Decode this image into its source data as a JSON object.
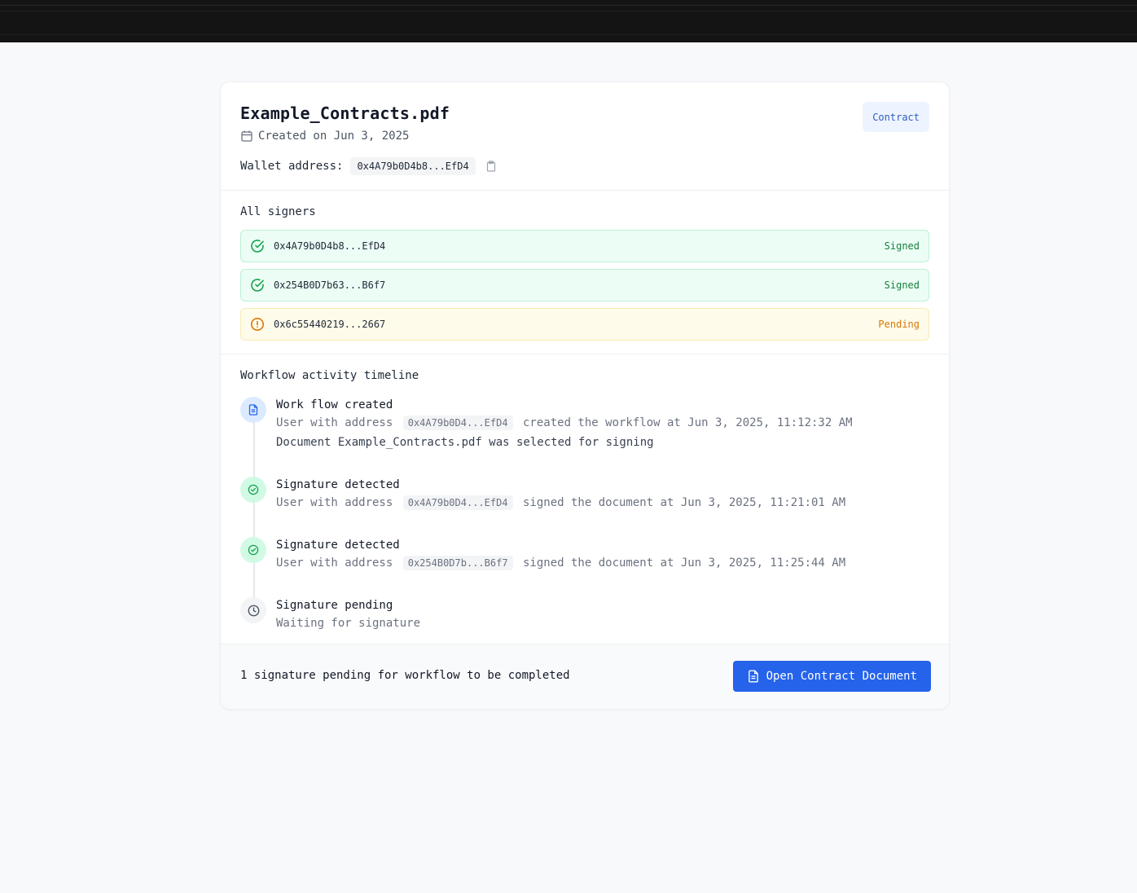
{
  "document": {
    "title": "Example_Contracts.pdf",
    "created": "Created on Jun 3, 2025",
    "type_badge": "Contract",
    "wallet_label": "Wallet address:",
    "wallet_address": "0x4A79b0D4b8...EfD4"
  },
  "signers": {
    "title": "All signers",
    "items": [
      {
        "address": "0x4A79b0D4b8...EfD4",
        "status": "Signed"
      },
      {
        "address": "0x254B0D7b63...B6f7",
        "status": "Signed"
      },
      {
        "address": "0x6c55440219...2667",
        "status": "Pending"
      }
    ]
  },
  "timeline": {
    "title": "Workflow activity timeline",
    "items": [
      {
        "title": "Work flow created",
        "prefix": "User with address",
        "address": "0x4A79b0D4...EfD4",
        "suffix": "created the workflow at Jun 3, 2025, 11:12:32 AM",
        "extra": "Document Example_Contracts.pdf was selected for signing"
      },
      {
        "title": "Signature detected",
        "prefix": "User with address",
        "address": "0x4A79b0D4...EfD4",
        "suffix": "signed the document at Jun 3, 2025, 11:21:01 AM"
      },
      {
        "title": "Signature detected",
        "prefix": "User with address",
        "address": "0x254B0D7b...B6f7",
        "suffix": "signed the document at Jun 3, 2025, 11:25:44 AM"
      },
      {
        "title": "Signature pending",
        "text": "Waiting for signature"
      }
    ]
  },
  "footer": {
    "pending_text": "1 signature pending for workflow to be completed",
    "open_button": "Open Contract Document"
  },
  "icons": {
    "calendar": "calendar-icon",
    "copy": "clipboard-icon",
    "signed": "check-circle-icon",
    "pending": "alert-circle-icon",
    "document": "file-text-icon",
    "clock": "clock-icon"
  },
  "colors": {
    "primary": "#2563eb",
    "signed_bg": "#ecfdf5",
    "signed_text": "#15803d",
    "pending_bg": "#fefbea",
    "pending_text": "#d97706",
    "badge_bg": "#eef4ff"
  }
}
